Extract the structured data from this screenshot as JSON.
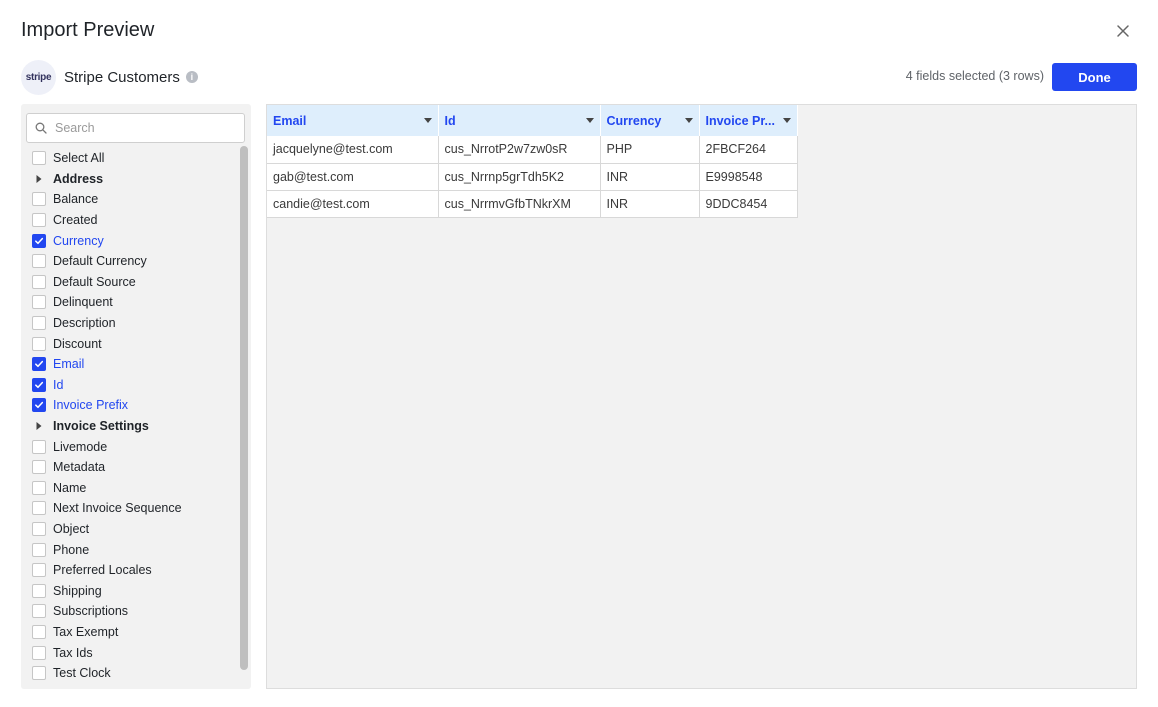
{
  "dialog": {
    "title": "Import Preview",
    "close_icon": "close-icon"
  },
  "source": {
    "logo_text": "stripe",
    "name": "Stripe Customers",
    "info_icon": "info-icon"
  },
  "summary": "4 fields selected (3 rows)",
  "done_label": "Done",
  "search": {
    "placeholder": "Search",
    "value": ""
  },
  "fields": [
    {
      "label": "Select All",
      "type": "checkbox",
      "checked": false
    },
    {
      "label": "Address",
      "type": "group",
      "checked": false
    },
    {
      "label": "Balance",
      "type": "checkbox",
      "checked": false
    },
    {
      "label": "Created",
      "type": "checkbox",
      "checked": false
    },
    {
      "label": "Currency",
      "type": "checkbox",
      "checked": true
    },
    {
      "label": "Default Currency",
      "type": "checkbox",
      "checked": false
    },
    {
      "label": "Default Source",
      "type": "checkbox",
      "checked": false
    },
    {
      "label": "Delinquent",
      "type": "checkbox",
      "checked": false
    },
    {
      "label": "Description",
      "type": "checkbox",
      "checked": false
    },
    {
      "label": "Discount",
      "type": "checkbox",
      "checked": false
    },
    {
      "label": "Email",
      "type": "checkbox",
      "checked": true
    },
    {
      "label": "Id",
      "type": "checkbox",
      "checked": true
    },
    {
      "label": "Invoice Prefix",
      "type": "checkbox",
      "checked": true
    },
    {
      "label": "Invoice Settings",
      "type": "group",
      "checked": false
    },
    {
      "label": "Livemode",
      "type": "checkbox",
      "checked": false
    },
    {
      "label": "Metadata",
      "type": "checkbox",
      "checked": false
    },
    {
      "label": "Name",
      "type": "checkbox",
      "checked": false
    },
    {
      "label": "Next Invoice Sequence",
      "type": "checkbox",
      "checked": false
    },
    {
      "label": "Object",
      "type": "checkbox",
      "checked": false
    },
    {
      "label": "Phone",
      "type": "checkbox",
      "checked": false
    },
    {
      "label": "Preferred Locales",
      "type": "checkbox",
      "checked": false
    },
    {
      "label": "Shipping",
      "type": "checkbox",
      "checked": false
    },
    {
      "label": "Subscriptions",
      "type": "checkbox",
      "checked": false
    },
    {
      "label": "Tax Exempt",
      "type": "checkbox",
      "checked": false
    },
    {
      "label": "Tax Ids",
      "type": "checkbox",
      "checked": false
    },
    {
      "label": "Test Clock",
      "type": "checkbox",
      "checked": false
    }
  ],
  "table": {
    "columns": [
      "Email",
      "Id",
      "Currency",
      "Invoice Pr..."
    ],
    "rows": [
      [
        "jacquelyne@test.com",
        "cus_NrrotP2w7zw0sR",
        "PHP",
        "2FBCF264"
      ],
      [
        "gab@test.com",
        "cus_Nrrnp5grTdh5K2",
        "INR",
        "E9998548"
      ],
      [
        "candie@test.com",
        "cus_NrrmvGfbTNkrXM",
        "INR",
        "9DDC8454"
      ]
    ]
  },
  "colors": {
    "accent": "#2247f0",
    "header_bg": "#deeefc",
    "panel_bg": "#f2f2f2"
  }
}
